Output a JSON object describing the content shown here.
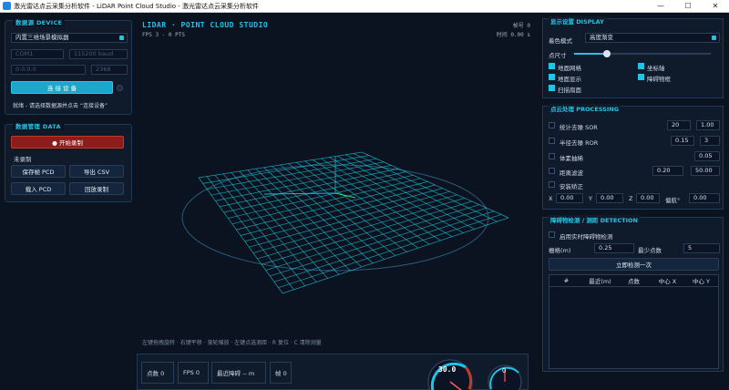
{
  "window": {
    "title": "激光雷达点云采集分析软件 - LiDAR Point Cloud Studio - 激光雷达点云采集分析软件",
    "min": "—",
    "max": "☐",
    "close": "✕"
  },
  "device": {
    "title": "数据源  DEVICE",
    "source": "内置三维场景模拟器",
    "port": "COM1",
    "baud": "115200 baud",
    "ip": "0.0.0.0",
    "ip_port": "2368",
    "connect_label": "连 接 设 备",
    "hint": "就绪 - 请选择数据源并点击 “连接设备”"
  },
  "data_mgmt": {
    "title": "数据管理  DATA",
    "record_label": "● 开始录制",
    "status": "未录制",
    "save_frame": "保存帧 PCD",
    "export_csv": "导出 CSV",
    "load_pcd": "载入 PCD",
    "playback": "回放录制"
  },
  "viewport": {
    "title": "LIDAR · POINT CLOUD STUDIO",
    "fps_line": "FPS 3   -   0 PTS",
    "frame_line": "帧号 0",
    "time_line": "时间 0.00 s",
    "hint": "左键拖拽旋转 · 右键平移 · 滚轮缩放 · 左键点选测距 · R 复位 · C 清除测量"
  },
  "stats": {
    "points": "点数 0",
    "fps": "FPS 0",
    "nearest": "最近障碍 -- m",
    "frame": "帧 0",
    "gauge_value": "30.0",
    "gauge2_value": "0"
  },
  "display": {
    "title": "显示设置  DISPLAY",
    "color_mode_label": "着色模式",
    "color_mode": "高度渐变",
    "point_size_label": "点尺寸",
    "point_size_fraction": 0.3,
    "show_grid": "地面网格",
    "show_axes": "坐标轴",
    "show_ground": "地面显示",
    "show_obstacle_box": "障碍物框",
    "show_scan_ring": "扫描扇面"
  },
  "processing": {
    "title": "点云处理  PROCESSING",
    "sor_label": "统计去噪 SOR",
    "sor_k": "20",
    "sor_std": "1.00",
    "ror_label": "半径去噪 ROR",
    "ror_r": "0.15",
    "ror_n": "3",
    "voxel_label": "体素抽稀",
    "voxel_size": "0.05",
    "range_label": "距离滤波",
    "range_min": "0.20",
    "range_max": "50.00",
    "mount_label": "安装矫正",
    "x_label": "X",
    "x_val": "0.00",
    "y_label": "Y",
    "y_val": "0.00",
    "z_label": "Z",
    "z_val": "0.00",
    "yaw_label": "偏航°",
    "yaw_val": "0.00"
  },
  "detection": {
    "title": "障碍物检测 / 测距  DETECTION",
    "realtime_label": "启用实时障碍物检测",
    "grid_label": "栅格(m)",
    "grid_val": "0.25",
    "min_pts_label": "最少点数",
    "min_pts_val": "5",
    "run_once": "立即检测一次",
    "columns": [
      "#",
      "最近(m)",
      "点数",
      "中心 X",
      "中心 Y"
    ]
  },
  "colors": {
    "accent": "#22c4e6",
    "bg": "#0b1220",
    "grid": "#1ec8d8",
    "record": "#8d1c1c"
  }
}
